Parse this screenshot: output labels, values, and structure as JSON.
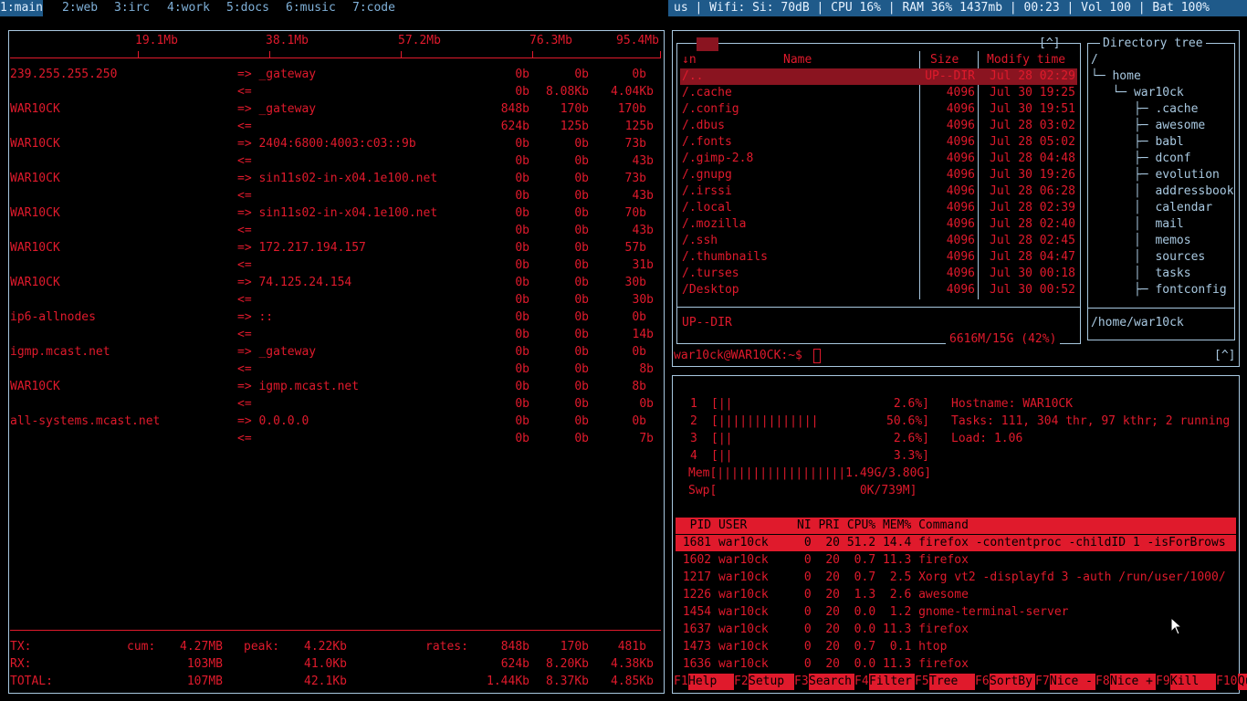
{
  "topbar": {
    "tags": [
      "1:main",
      "2:web",
      "3:irc",
      "4:work",
      "5:docs",
      "6:music",
      "7:code"
    ],
    "status": "us | Wifi: Si: 70dB | CPU 16% | RAM 36% 1437mb | 00:23 | Vol 100 | Bat 100%"
  },
  "iftop": {
    "scale": [
      "19.1Mb",
      "38.1Mb",
      "57.2Mb",
      "76.3Mb",
      "95.4Mb"
    ],
    "flows": [
      {
        "src": "239.255.255.250",
        "dst": "_gateway",
        "out": [
          "0b",
          "0b",
          "0b"
        ],
        "in": [
          "0b",
          "8.08Kb",
          "4.04Kb"
        ]
      },
      {
        "src": "WAR10CK",
        "dst": "_gateway",
        "out": [
          "848b",
          "170b",
          "170b"
        ],
        "in": [
          "624b",
          "125b",
          "125b"
        ]
      },
      {
        "src": "WAR10CK",
        "dst": "2404:6800:4003:c03::9b",
        "out": [
          "0b",
          "0b",
          "73b"
        ],
        "in": [
          "0b",
          "0b",
          "43b"
        ]
      },
      {
        "src": "WAR10CK",
        "dst": "sin11s02-in-x04.1e100.net",
        "out": [
          "0b",
          "0b",
          "73b"
        ],
        "in": [
          "0b",
          "0b",
          "43b"
        ]
      },
      {
        "src": "WAR10CK",
        "dst": "sin11s02-in-x04.1e100.net",
        "out": [
          "0b",
          "0b",
          "70b"
        ],
        "in": [
          "0b",
          "0b",
          "43b"
        ]
      },
      {
        "src": "WAR10CK",
        "dst": "172.217.194.157",
        "out": [
          "0b",
          "0b",
          "57b"
        ],
        "in": [
          "0b",
          "0b",
          "31b"
        ]
      },
      {
        "src": "WAR10CK",
        "dst": "74.125.24.154",
        "out": [
          "0b",
          "0b",
          "30b"
        ],
        "in": [
          "0b",
          "0b",
          "30b"
        ]
      },
      {
        "src": "ip6-allnodes",
        "dst": "::",
        "out": [
          "0b",
          "0b",
          "0b"
        ],
        "in": [
          "0b",
          "0b",
          "14b"
        ]
      },
      {
        "src": "igmp.mcast.net",
        "dst": "_gateway",
        "out": [
          "0b",
          "0b",
          "0b"
        ],
        "in": [
          "0b",
          "0b",
          "8b"
        ]
      },
      {
        "src": "WAR10CK",
        "dst": "igmp.mcast.net",
        "out": [
          "0b",
          "0b",
          "8b"
        ],
        "in": [
          "0b",
          "0b",
          "0b"
        ]
      },
      {
        "src": "all-systems.mcast.net",
        "dst": "0.0.0.0",
        "out": [
          "0b",
          "0b",
          "0b"
        ],
        "in": [
          "0b",
          "0b",
          "7b"
        ]
      }
    ],
    "out_arrow": "=>",
    "in_arrow": "<=",
    "footer": {
      "tx_label": "TX:",
      "rx_label": "RX:",
      "total_label": "TOTAL:",
      "cum_label": "cum:",
      "peak_label": "peak:",
      "rates_label": "rates:",
      "tx": {
        "cum": "4.27MB",
        "peak": "4.22Kb",
        "rates": [
          "848b",
          "170b",
          "481b"
        ]
      },
      "rx": {
        "cum": "103MB",
        "peak": "41.0Kb",
        "rates": [
          "624b",
          "8.20Kb",
          "4.38Kb"
        ]
      },
      "total": {
        "cum": "107MB",
        "peak": "42.1Kb",
        "rates": [
          "1.44Kb",
          "8.37Kb",
          "4.85Kb"
        ]
      }
    }
  },
  "mc": {
    "top_right": "[^]",
    "sort_indicator": "↓n",
    "col_name": "Name",
    "col_size": "Size",
    "col_mtime": "Modify time",
    "files": [
      {
        "name": "/..",
        "size": "UP--DIR",
        "mtime": "Jul 28 02:29"
      },
      {
        "name": "/.cache",
        "size": "4096",
        "mtime": "Jul 30 19:25"
      },
      {
        "name": "/.config",
        "size": "4096",
        "mtime": "Jul 30 19:51"
      },
      {
        "name": "/.dbus",
        "size": "4096",
        "mtime": "Jul 28 03:02"
      },
      {
        "name": "/.fonts",
        "size": "4096",
        "mtime": "Jul 28 05:02"
      },
      {
        "name": "/.gimp-2.8",
        "size": "4096",
        "mtime": "Jul 28 04:48"
      },
      {
        "name": "/.gnupg",
        "size": "4096",
        "mtime": "Jul 30 19:26"
      },
      {
        "name": "/.irssi",
        "size": "4096",
        "mtime": "Jul 28 06:28"
      },
      {
        "name": "/.local",
        "size": "4096",
        "mtime": "Jul 28 02:39"
      },
      {
        "name": "/.mozilla",
        "size": "4096",
        "mtime": "Jul 28 02:40"
      },
      {
        "name": "/.ssh",
        "size": "4096",
        "mtime": "Jul 28 02:45"
      },
      {
        "name": "/.thumbnails",
        "size": "4096",
        "mtime": "Jul 28 04:47"
      },
      {
        "name": "/.turses",
        "size": "4096",
        "mtime": "Jul 30 00:18"
      },
      {
        "name": "/Desktop",
        "size": "4096",
        "mtime": "Jul 30 00:52"
      }
    ],
    "mini_status": "UP--DIR",
    "disk": "6616M/15G (42%)",
    "tree_title": "Directory tree",
    "tree": [
      "/",
      "└─ home",
      "   └─ war10ck",
      "      ├─ .cache",
      "      ├─ awesome",
      "      ├─ babl",
      "      ├─ dconf",
      "      ├─ evolution",
      "      │  addressbook",
      "      │  calendar",
      "      │  mail",
      "      │  memos",
      "      │  sources",
      "      │  tasks",
      "      ├─ fontconfig"
    ],
    "tree_path": "/home/war10ck",
    "prompt": "war10ck@WAR10CK:~$ ",
    "prompt_right": "[^]"
  },
  "htop": {
    "cpus": [
      {
        "n": "1",
        "bar": "||",
        "pct": "2.6%"
      },
      {
        "n": "2",
        "bar": "||||||||||||||",
        "pct": "50.6%"
      },
      {
        "n": "3",
        "bar": "||",
        "pct": "2.6%"
      },
      {
        "n": "4",
        "bar": "||",
        "pct": "3.3%"
      }
    ],
    "mem": "Mem[||||||||||||||||||1.49G/3.80G]",
    "swp": "Swp[                    0K/739M]",
    "hostname": "Hostname: WAR10CK",
    "tasks": "Tasks: 111, 304 thr, 97 kthr; 2 running",
    "load": "Load: 1.06",
    "header": "  PID USER       NI PRI CPU% MEM% Command",
    "procs": [
      " 1681 war10ck     0  20 51.2 14.4 firefox -contentproc -childID 1 -isForBrows",
      " 1602 war10ck     0  20  0.7 11.3 firefox",
      " 1217 war10ck     0  20  0.7  2.5 Xorg vt2 -displayfd 3 -auth /run/user/1000/",
      " 1226 war10ck     0  20  1.3  2.6 awesome",
      " 1454 war10ck     0  20  0.0  1.2 gnome-terminal-server",
      " 1637 war10ck     0  20  0.0 11.3 firefox",
      " 1473 war10ck     0  20  0.7  0.1 htop",
      " 1636 war10ck     0  20  0.0 11.3 firefox"
    ],
    "fkeys": [
      {
        "k": "F1",
        "l": "Help  "
      },
      {
        "k": "F2",
        "l": "Setup "
      },
      {
        "k": "F3",
        "l": "Search"
      },
      {
        "k": "F4",
        "l": "Filter"
      },
      {
        "k": "F5",
        "l": "Tree  "
      },
      {
        "k": "F6",
        "l": "SortBy"
      },
      {
        "k": "F7",
        "l": "Nice -"
      },
      {
        "k": "F8",
        "l": "Nice +"
      },
      {
        "k": "F9",
        "l": "Kill  "
      },
      {
        "k": "F10",
        "l": "Qu"
      }
    ]
  },
  "colors": {
    "accent": "#e01a2c",
    "border": "#a8c8e0",
    "statusbar": "#1f5a8a"
  }
}
